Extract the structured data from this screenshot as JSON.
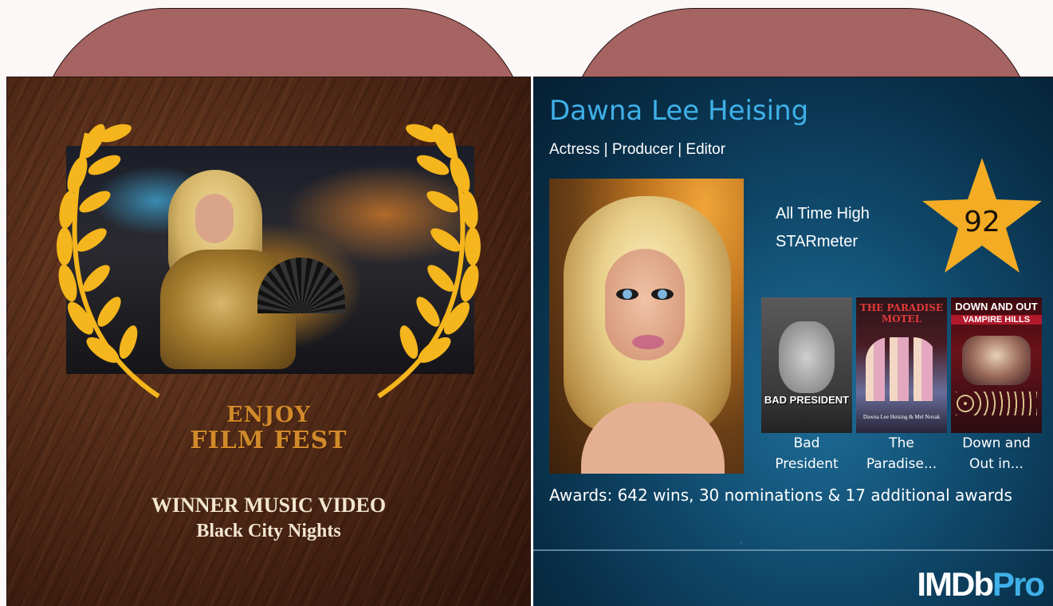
{
  "festival": {
    "laurel_line1": "ENJOY",
    "laurel_line2": "FILM FEST",
    "award_line1": "WINNER MUSIC VIDEO",
    "award_line2": "Black City Nights"
  },
  "profile": {
    "name": "Dawna Lee Heising",
    "roles": "Actress | Producer | Editor",
    "starmeter_label_line1": "All Time High",
    "starmeter_label_line2": "STARmeter",
    "starmeter_value": "92",
    "known_for": [
      {
        "title_line1": "Bad",
        "title_line2": "President",
        "poster_text": "BAD PRESIDENT"
      },
      {
        "title_line1": "The",
        "title_line2": "Paradise...",
        "poster_text": "THE PARADISE MOTEL",
        "poster_credit": "Dawna Lee Heising & Mel Novak"
      },
      {
        "title_line1": "Down and",
        "title_line2": "Out in...",
        "poster_text_line1": "DOWN AND OUT IN",
        "poster_text_line2": "VAMPIRE HILLS"
      }
    ],
    "awards": "Awards: 642 wins, 30 nominations & 17 additional awards",
    "logo_imdb": "IMDb",
    "logo_pro": "Pro"
  },
  "colors": {
    "arch": "#a56361",
    "name_blue": "#3fb0e8",
    "star_gold": "#f3ac24",
    "laurel_gold": "#f5b51c",
    "fest_orange": "#d18a2a"
  }
}
